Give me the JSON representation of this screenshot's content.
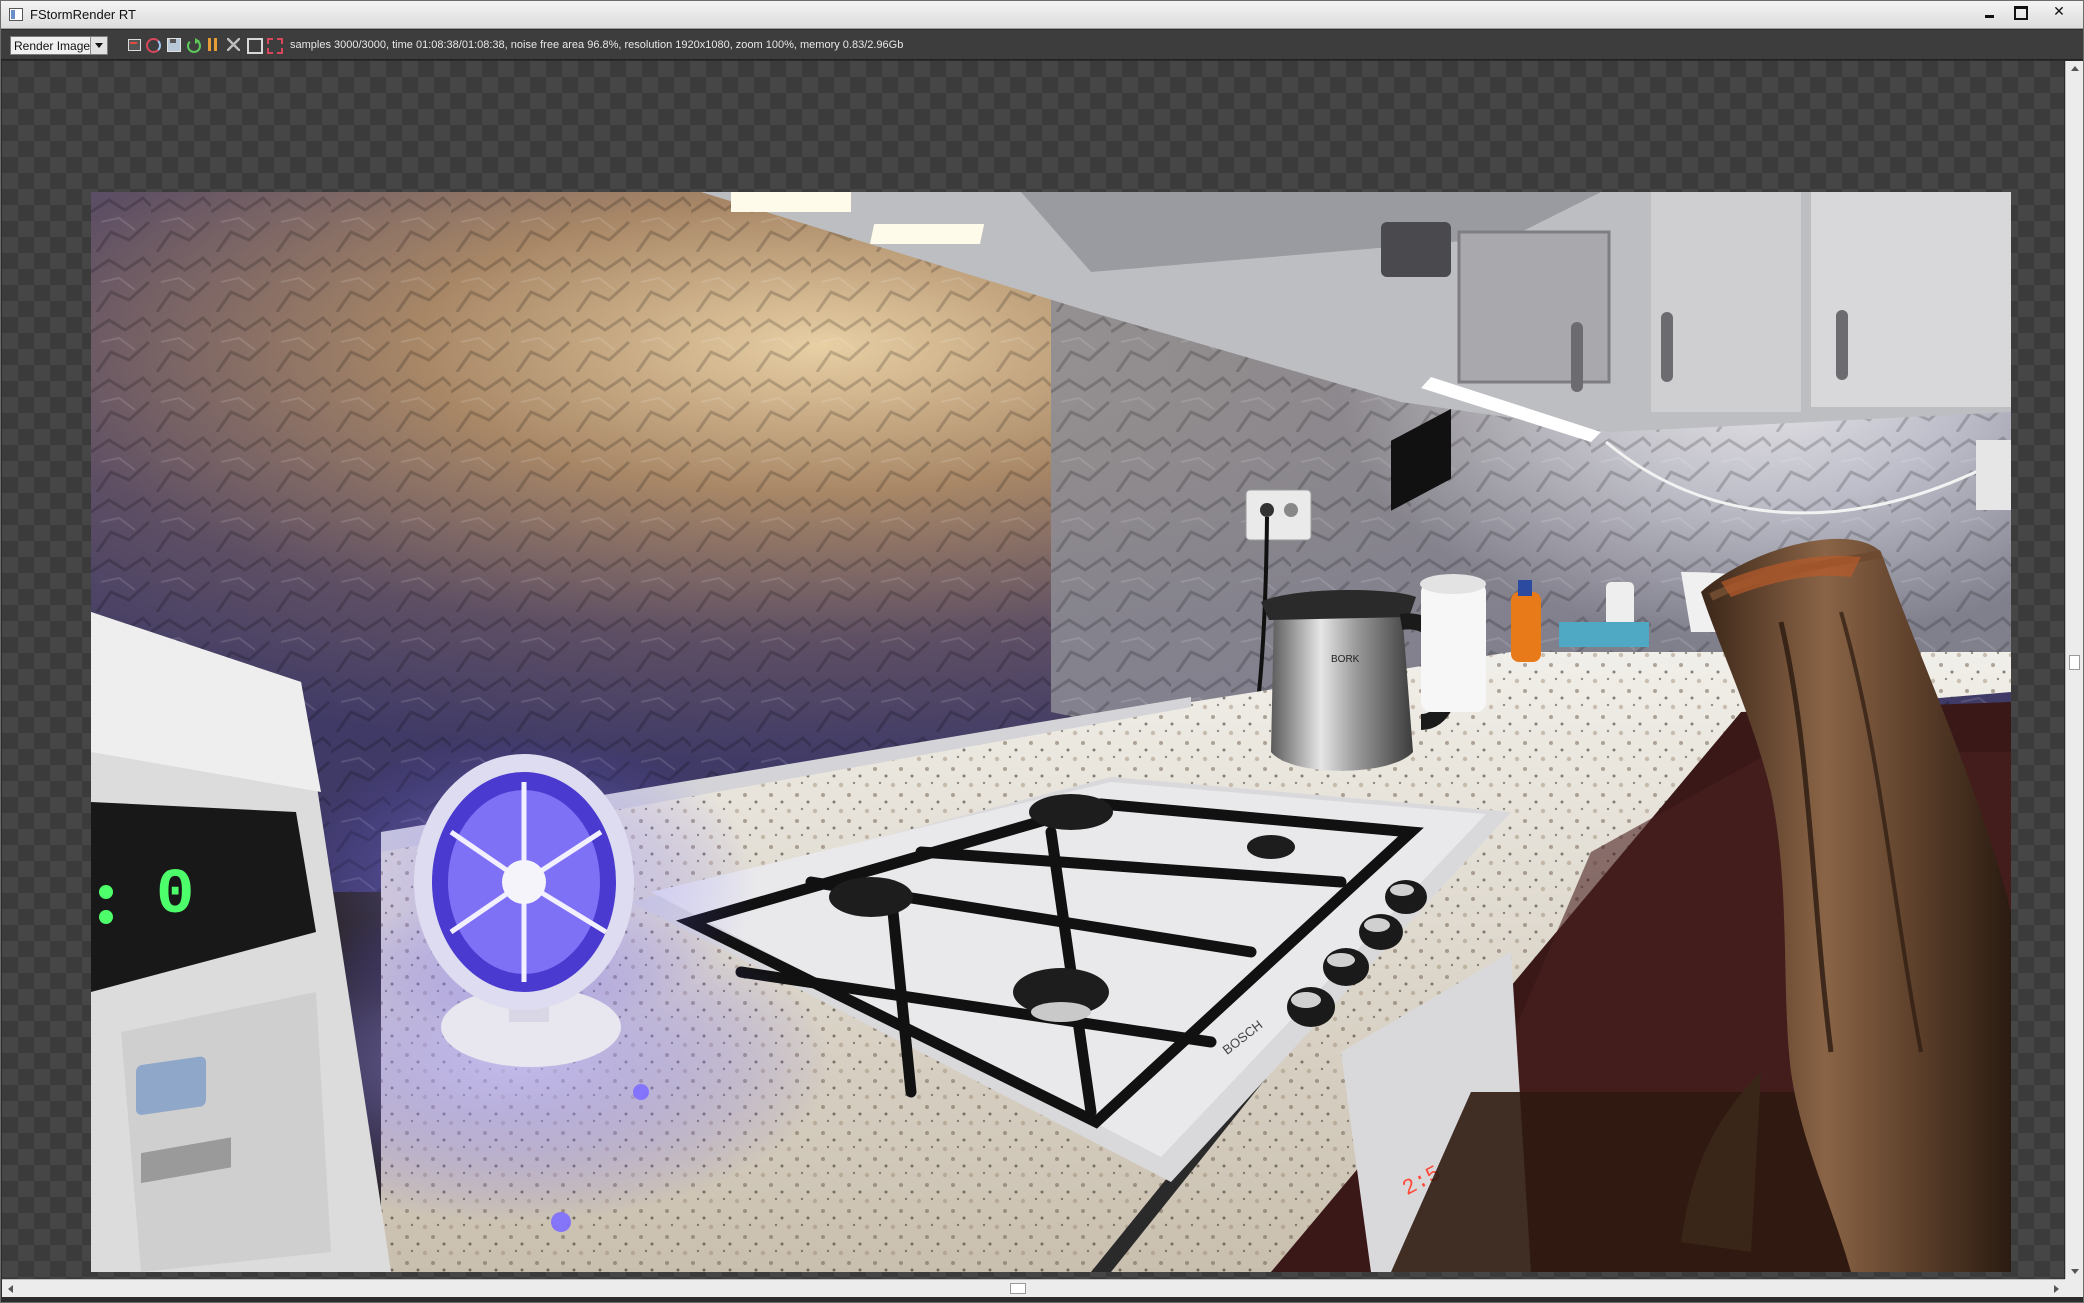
{
  "window": {
    "title": "FStormRender RT",
    "minimize_icon": "minimize-icon",
    "maximize_icon": "maximize-icon",
    "close_icon": "close-icon",
    "close_glyph": "✕"
  },
  "toolbar": {
    "view_select": {
      "value": "Render Image"
    },
    "icons": [
      "save-render-icon",
      "refresh-icon",
      "save-icon",
      "restart-icon",
      "pause-icon",
      "fit-view-icon",
      "frame-icon",
      "region-render-icon"
    ],
    "status": "samples 3000/3000,  time 01:08:38/01:08:38,  noise free area 96.8%,  resolution 1920x1080,  zoom 100%,  memory 0.83/2.96Gb"
  },
  "render": {
    "description_icon": "render-image",
    "microwave_display": "0",
    "kettle_brand": "BORK",
    "hob_brand": "BOSCH",
    "oven_display": "2:5"
  },
  "colors": {
    "viewport_bg": "#3b3b3b",
    "checker": "#464646",
    "accent_blue": "#6a5cff",
    "warm_light": "#f2c98a"
  }
}
